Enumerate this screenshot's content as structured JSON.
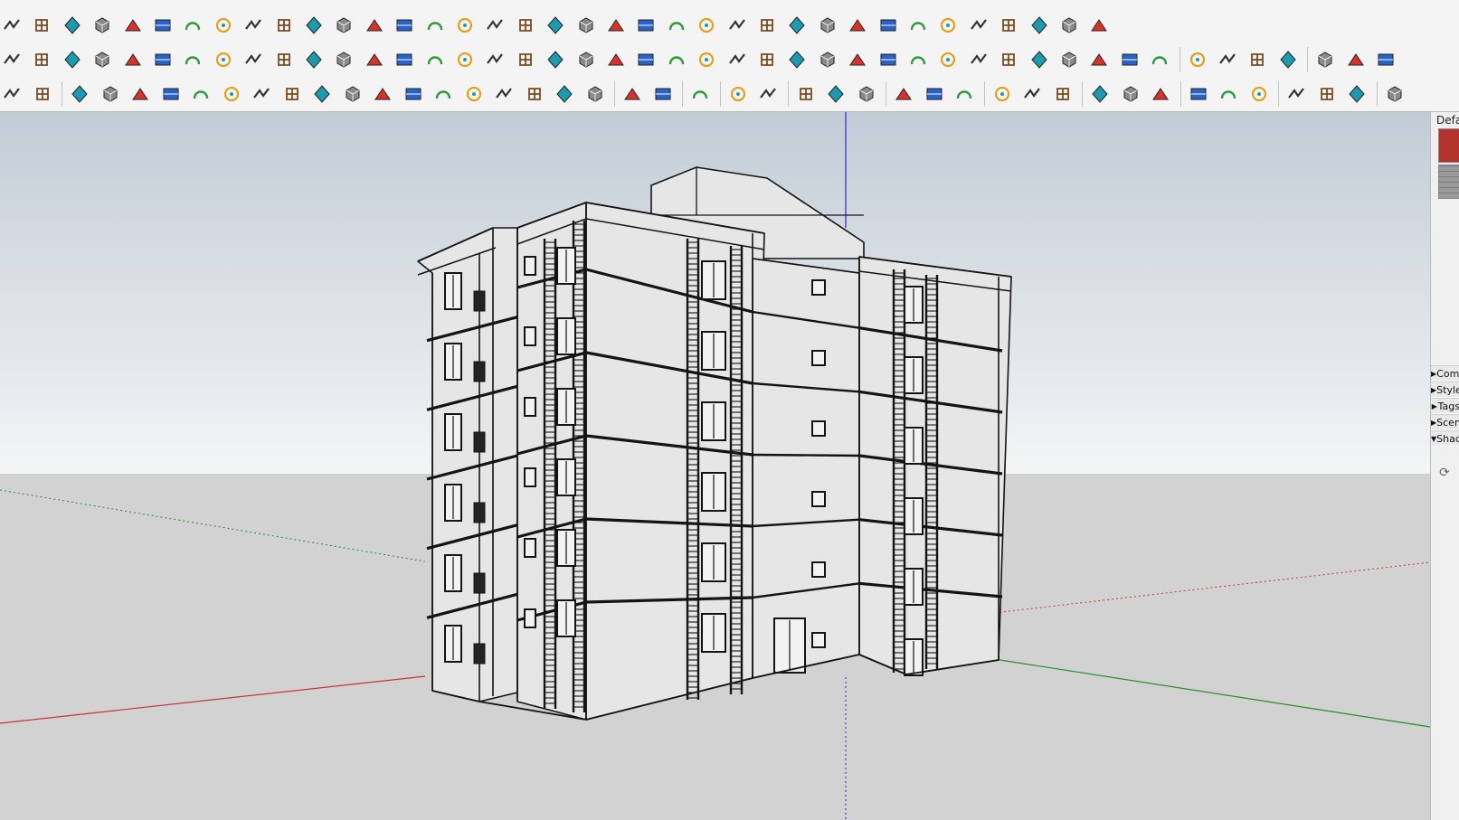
{
  "toolbars": {
    "row1": [
      "push-pull",
      "paint",
      "intersect",
      "offset",
      "follow-me",
      "solid-union",
      "solid-subtract",
      "solid-trim",
      "fillet",
      "chamfer",
      "extend",
      "curve-tool",
      "tube",
      "shell",
      "stairs-curved",
      "grid-columns",
      "hand-tool",
      "surface",
      "arrow-tool",
      "roof-lines",
      "slope",
      "profile-a",
      "profile-b",
      "profile-c",
      "dome",
      "hatch-a",
      "panel",
      "music-note",
      "grid-hatch",
      "stripes-a",
      "stripes-b",
      "stripes-c",
      "hatch-b",
      "hatch-c",
      "fan-lines",
      "stripes-d",
      "paint-bucket"
    ],
    "row2": [
      "layer-blue",
      "layer-gold",
      "layer-green",
      "layer-red",
      "layer-white",
      "rotate-orange",
      "solid-red",
      "list-frame",
      "flag",
      "box-brown",
      "arrow-gray",
      "corner-arc",
      "polyline",
      "cross-red",
      "cross-green",
      "puzzle-blue",
      "cone-teal",
      "cone-green",
      "triangle",
      "circle-arrow",
      "loop-orange",
      "loop-blue",
      "move-blue",
      "cube-brown",
      "undo-red",
      "flow-green",
      "explode-a",
      "explode-b",
      "explode-c",
      "gem-red",
      "mesh",
      "square-frame",
      "grid-orange-a",
      "grid-orange-b",
      "grid-orange-c",
      "points-x",
      "dotted-circle",
      "grid-small",
      "pencil-line",
      "ruler",
      "bucket-dark",
      "prism",
      "cube-blue",
      "paper-plane",
      "gray-curve",
      "scales"
    ],
    "row3": [
      "point",
      "wire-shape",
      "arc-n",
      "zigzag",
      "crack",
      "wave",
      "spring",
      "arc-green",
      "rectangle",
      "spiral",
      "arc-open",
      "curve-s",
      "hook",
      "arc-small",
      "arc-red",
      "vee",
      "hexagon",
      "wrench",
      "ellipse",
      "arrow-red",
      "green-slab",
      "green-house",
      "cursor-select",
      "scale-up",
      "scale-down",
      "align-a",
      "align-b",
      "align-c",
      "divide-a",
      "divide-b",
      "divide-c",
      "grid-cross-a",
      "grid-cross-b",
      "grid-cross-c",
      "window-blue-a",
      "window-blue-b",
      "window-grid",
      "texture-a",
      "texture-b",
      "tree",
      "checker",
      "copy",
      "clip",
      "components"
    ]
  },
  "tray": {
    "title": "Default Tray",
    "colors": {
      "swatch_red": "#b5332e",
      "swatch_gray": "#8a8a8a"
    },
    "panels": [
      {
        "label": "Components",
        "arrow": "right"
      },
      {
        "label": "Styles",
        "arrow": "right"
      },
      {
        "label": "Tags",
        "arrow": "right"
      },
      {
        "label": "Scenes",
        "arrow": "right"
      },
      {
        "label": "Shadows",
        "arrow": "down"
      }
    ]
  },
  "viewport": {
    "sky_top": "#c2ccd6",
    "sky_bottom": "#f4f5f5",
    "ground": "#d2d2d2",
    "axis_red": "#c8323a",
    "axis_green": "#2c8b2c",
    "axis_blue": "#2a2ac8",
    "building_fill": "#e6e6e6",
    "building_edge": "#141414"
  }
}
